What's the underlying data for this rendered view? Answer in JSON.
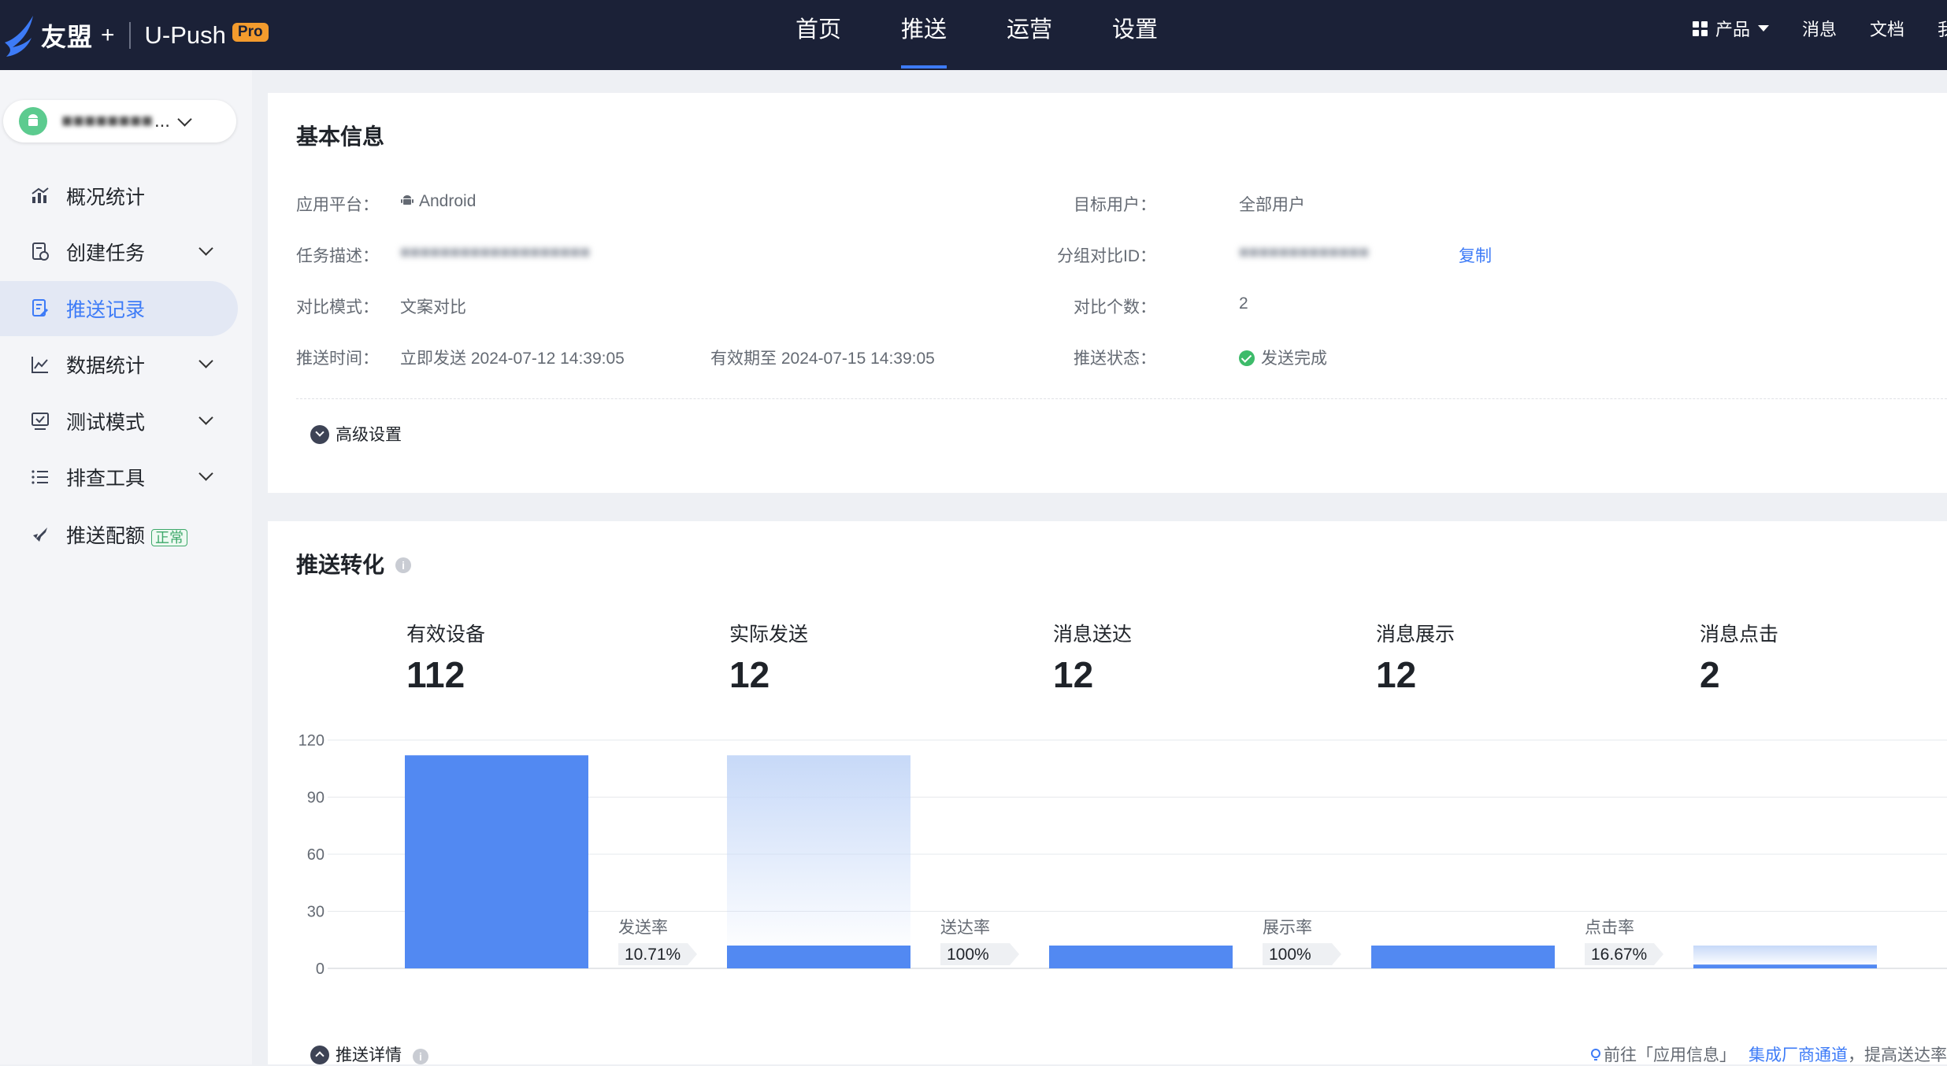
{
  "brand": {
    "name": "友盟",
    "plus": "+",
    "product": "U-Push",
    "badge": "Pro"
  },
  "nav": {
    "items": [
      "首页",
      "推送",
      "运营",
      "设置"
    ],
    "active": "推送"
  },
  "top_right": {
    "product": "产品",
    "messages": "消息",
    "docs": "文档",
    "partial": "我"
  },
  "sidebar": {
    "app_ellipsis": "...",
    "items": [
      {
        "label": "概况统计"
      },
      {
        "label": "创建任务"
      },
      {
        "label": "推送记录"
      },
      {
        "label": "数据统计"
      },
      {
        "label": "测试模式"
      },
      {
        "label": "排查工具"
      },
      {
        "label": "推送配额",
        "badge": "正常"
      }
    ]
  },
  "basic": {
    "title": "基本信息",
    "platform_label": "应用平台：",
    "platform_value": "Android",
    "desc_label": "任务描述：",
    "mode_label": "对比模式：",
    "mode_value": "文案对比",
    "time_label": "推送时间：",
    "send_time": "立即发送 2024-07-12 14:39:05",
    "valid_until": "有效期至 2024-07-15 14:39:05",
    "target_label": "目标用户：",
    "target_value": "全部用户",
    "group_label": "分组对比ID：",
    "copy": "复制",
    "count_label": "对比个数：",
    "count_value": "2",
    "status_label": "推送状态：",
    "status_value": "发送完成",
    "advanced": "高级设置"
  },
  "conversion": {
    "title": "推送转化",
    "info": "i",
    "stats": [
      {
        "label": "有效设备",
        "value": "112"
      },
      {
        "label": "实际发送",
        "value": "12"
      },
      {
        "label": "消息送达",
        "value": "12"
      },
      {
        "label": "消息展示",
        "value": "12"
      },
      {
        "label": "消息点击",
        "value": "2"
      }
    ],
    "details": "推送详情",
    "tip_prefix": "前往「应用信息」",
    "tip_link": "集成厂商通道",
    "tip_suffix": "，提高送达率"
  },
  "chart_data": {
    "type": "bar",
    "categories": [
      "有效设备",
      "实际发送",
      "消息送达",
      "消息展示",
      "消息点击"
    ],
    "values": [
      112,
      12,
      12,
      12,
      2
    ],
    "ylim": [
      0,
      120
    ],
    "yticks": [
      0,
      30,
      60,
      90,
      120
    ],
    "grid": true,
    "rates": [
      {
        "label": "发送率",
        "value": "10.71%"
      },
      {
        "label": "送达率",
        "value": "100%"
      },
      {
        "label": "展示率",
        "value": "100%"
      },
      {
        "label": "点击率",
        "value": "16.67%"
      }
    ],
    "colors": {
      "bar": "#5289f2",
      "ghost": "#c7d9f8",
      "grid": "#e6e8ec"
    }
  }
}
